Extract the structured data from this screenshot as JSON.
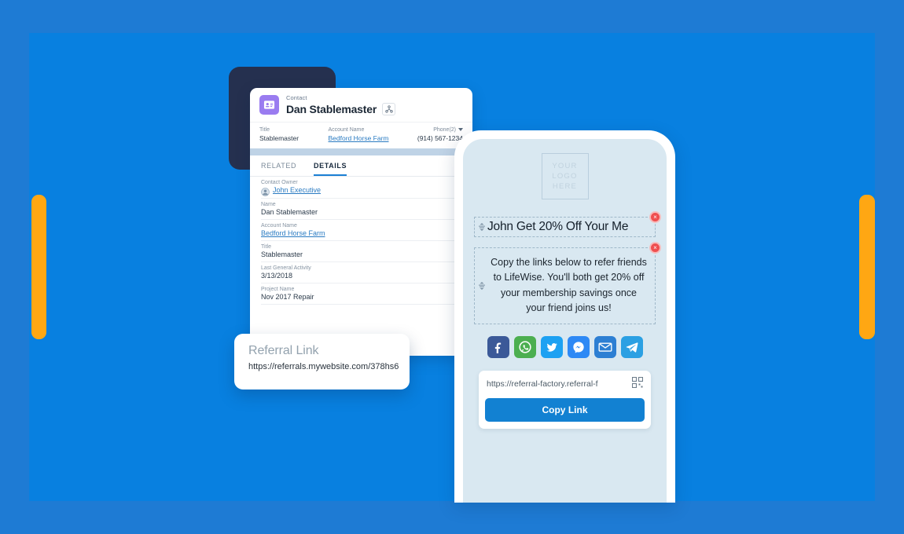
{
  "theme": {
    "outer_blue": "#1e7bd4",
    "panel_blue": "#0880e0",
    "orange": "#ffa713",
    "navy": "#25304f",
    "phone_screen": "#d9e8f1",
    "accent_button": "#1281d2",
    "link_blue": "#2a7bc2"
  },
  "salesforce_card": {
    "object_label": "Contact",
    "record_name": "Dan Stablemaster",
    "share_icon": "share-hierarchy-icon",
    "avatar_icon": "contact-card-icon",
    "highlight_fields": [
      {
        "label": "Title",
        "value": "Stablemaster",
        "is_link": false
      },
      {
        "label": "Account Name",
        "value": "Bedford Horse Farm",
        "is_link": true
      },
      {
        "label": "Phone(2)",
        "value": "(914) 567-1234",
        "is_link": false
      }
    ],
    "tabs": [
      {
        "label": "RELATED",
        "active": false
      },
      {
        "label": "DETAILS",
        "active": true
      }
    ],
    "details": [
      {
        "label": "Contact Owner",
        "value": "John Executive",
        "is_link": true,
        "has_avatar": true
      },
      {
        "label": "Name",
        "value": "Dan Stablemaster",
        "is_link": false,
        "has_avatar": false
      },
      {
        "label": "Account Name",
        "value": "Bedford Horse Farm",
        "is_link": true,
        "has_avatar": false
      },
      {
        "label": "Title",
        "value": "Stablemaster",
        "is_link": false,
        "has_avatar": false
      },
      {
        "label": "Last General Activity",
        "value": "3/13/2018",
        "is_link": false,
        "has_avatar": false
      },
      {
        "label": "Project Name",
        "value": "Nov 2017 Repair",
        "is_link": false,
        "has_avatar": false
      }
    ]
  },
  "referral_card": {
    "title": "Referral Link",
    "url": "https://referrals.mywebsite.com/378hs6"
  },
  "phone": {
    "logo_placeholder": {
      "line1": "YOUR",
      "line2": "LOGO",
      "line3": "HERE"
    },
    "headline": "John Get 20% Off Your Me",
    "body": "Copy the links below to refer friends to LifeWise. You'll both get 20% off your membership savings once your friend joins us!",
    "close_badge_glyph": "×",
    "drag_handle_icon": "drag-handle-icon",
    "social_buttons": [
      {
        "name": "facebook",
        "color": "#3b5998"
      },
      {
        "name": "whatsapp",
        "color": "#4caf50"
      },
      {
        "name": "twitter",
        "color": "#1da1f2"
      },
      {
        "name": "messenger",
        "color": "#2e89f5"
      },
      {
        "name": "email",
        "color": "#2d7fd3"
      },
      {
        "name": "telegram",
        "color": "#2ba0e3"
      }
    ],
    "link_value": "https://referral-factory.referral-f",
    "qr_icon": "qr-code-icon",
    "copy_button_label": "Copy Link"
  }
}
